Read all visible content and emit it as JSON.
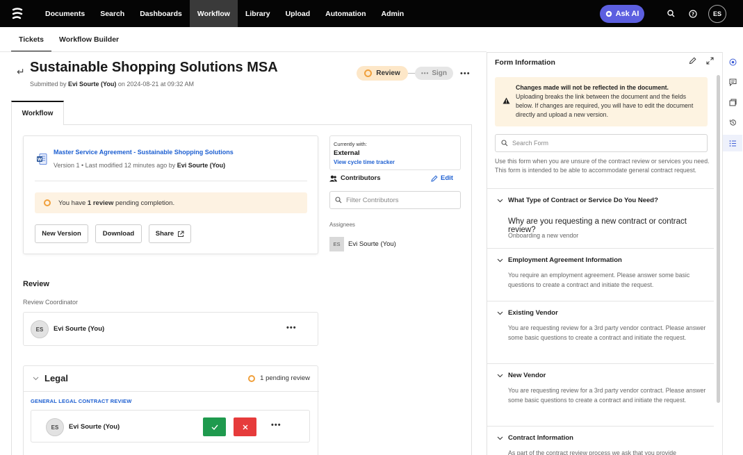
{
  "nav": {
    "items": [
      "Documents",
      "Search",
      "Dashboards",
      "Workflow",
      "Library",
      "Upload",
      "Automation",
      "Admin"
    ],
    "active": "Workflow",
    "ask_ai": "Ask AI",
    "user_initials": "ES"
  },
  "subtabs": {
    "tickets": "Tickets",
    "builder": "Workflow Builder"
  },
  "ticket": {
    "title": "Sustainable Shopping Solutions MSA",
    "submitted_prefix": "Submitted by ",
    "submitter": "Evi Sourte (You)",
    "submitted_suffix": " on 2024-08-21 at 09:32 AM",
    "stage_review": "Review",
    "stage_sign": "Sign"
  },
  "workflow_tab": "Workflow",
  "document": {
    "link": "Master Service Agreement - Sustainable Shopping Solutions",
    "meta_prefix": "Version 1 • Last modified 12 minutes ago by ",
    "meta_user": "Evi Sourte (You)",
    "pending_prefix": "You have ",
    "pending_bold": "1 review",
    "pending_suffix": " pending completion.",
    "new_version": "New Version",
    "download": "Download",
    "share": "Share"
  },
  "currently_with": {
    "label": "Currently with:",
    "value": "External",
    "link": "View cycle time tracker"
  },
  "contributors": {
    "title": "Contributors",
    "edit": "Edit",
    "filter_placeholder": "Filter Contributors",
    "assignees_label": "Assignees",
    "assignee_initials": "ES",
    "assignee_name": "Evi Sourte (You)"
  },
  "review": {
    "heading": "Review",
    "coordinator_label": "Review Coordinator",
    "coordinator_initials": "ES",
    "coordinator_name": "Evi Sourte (You)"
  },
  "legal": {
    "title": "Legal",
    "pending": "1 pending review",
    "link": "GENERAL LEGAL CONTRACT REVIEW",
    "reviewer_initials": "ES",
    "reviewer_name": "Evi Sourte (You)"
  },
  "form_info": {
    "title": "Form Information",
    "warning_title": "Changes made will not be reflected in the document.",
    "warning_body": "Uploading breaks the link between the document and the fields below. If changes are required, you will have to edit the document directly and upload a new version.",
    "search_placeholder": "Search Form",
    "description": "Use this form when you are unsure of the contract review or services you need. This form is intended to be able to accommodate general contract request.",
    "sections": [
      {
        "title": "What Type of Contract or Service Do You Need?",
        "question": "Why are you requesting a new contract or contract review?",
        "answer": "Onboarding a new vendor"
      },
      {
        "title": "Employment Agreement Information",
        "body": "You require an employment agreement. Please answer some basic questions to create a contract and initiate the request."
      },
      {
        "title": "Existing Vendor",
        "body": "You are requesting review for a 3rd party vendor contract. Please answer some basic questions to create a contract and initiate the request."
      },
      {
        "title": "New Vendor",
        "body": "You are requesting review for a 3rd party vendor contract. Please answer some basic questions to create a contract and initiate the request."
      },
      {
        "title": "Contract Information",
        "body": "As part of the contract review process we ask that you provide"
      }
    ]
  },
  "colors": {
    "accent": "#1d5fd1",
    "ask_ai": "#5c5fe0",
    "review_stage": "#fde7c8",
    "approve": "#1f9a4e",
    "reject": "#e63b3b"
  }
}
